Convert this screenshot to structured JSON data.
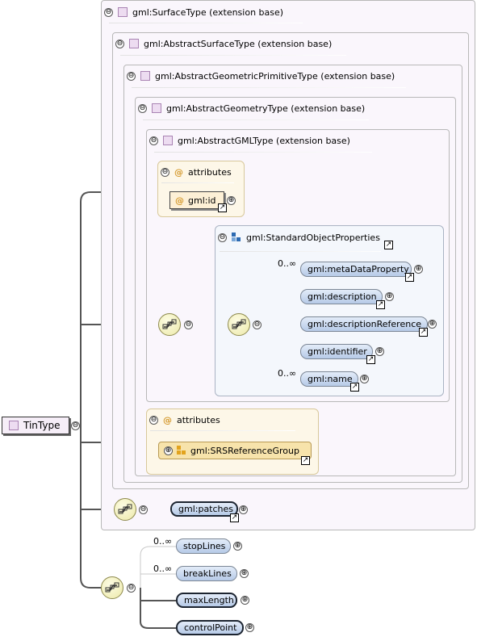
{
  "root": {
    "label": "TinType"
  },
  "extensions": [
    {
      "label": "gml:SurfaceType (extension base)"
    },
    {
      "label": "gml:AbstractSurfaceType (extension base)"
    },
    {
      "label": "gml:AbstractGeometricPrimitiveType (extension base)"
    },
    {
      "label": "gml:AbstractGeometryType (extension base)"
    },
    {
      "label": "gml:AbstractGMLType (extension base)"
    }
  ],
  "attributes1": {
    "label": "attributes",
    "items": [
      {
        "label": "gml:id"
      }
    ]
  },
  "group": {
    "label": "gml:StandardObjectProperties",
    "elements": [
      {
        "label": "gml:metaDataProperty",
        "cardinality": "0..∞"
      },
      {
        "label": "gml:description",
        "cardinality": ""
      },
      {
        "label": "gml:descriptionReference",
        "cardinality": ""
      },
      {
        "label": "gml:identifier",
        "cardinality": ""
      },
      {
        "label": "gml:name",
        "cardinality": "0..∞"
      }
    ]
  },
  "attributes2": {
    "label": "attributes",
    "ref": "gml:SRSReferenceGroup"
  },
  "patches": {
    "label": "gml:patches"
  },
  "tin_elements": [
    {
      "label": "stopLines",
      "cardinality": "0..∞",
      "required": false
    },
    {
      "label": "breakLines",
      "cardinality": "0..∞",
      "required": false
    },
    {
      "label": "maxLength",
      "cardinality": "",
      "required": true
    },
    {
      "label": "controlPoint",
      "cardinality": "",
      "required": true
    }
  ],
  "symbols": {
    "collapse": "⊖",
    "expand": "⊕",
    "link": "↗",
    "attribute": "@"
  },
  "colors": {
    "connector": "#555555",
    "element_fill": "#c9d8ef",
    "attribute_fill": "#fdf7e8",
    "type_icon": "#eddcf1"
  }
}
